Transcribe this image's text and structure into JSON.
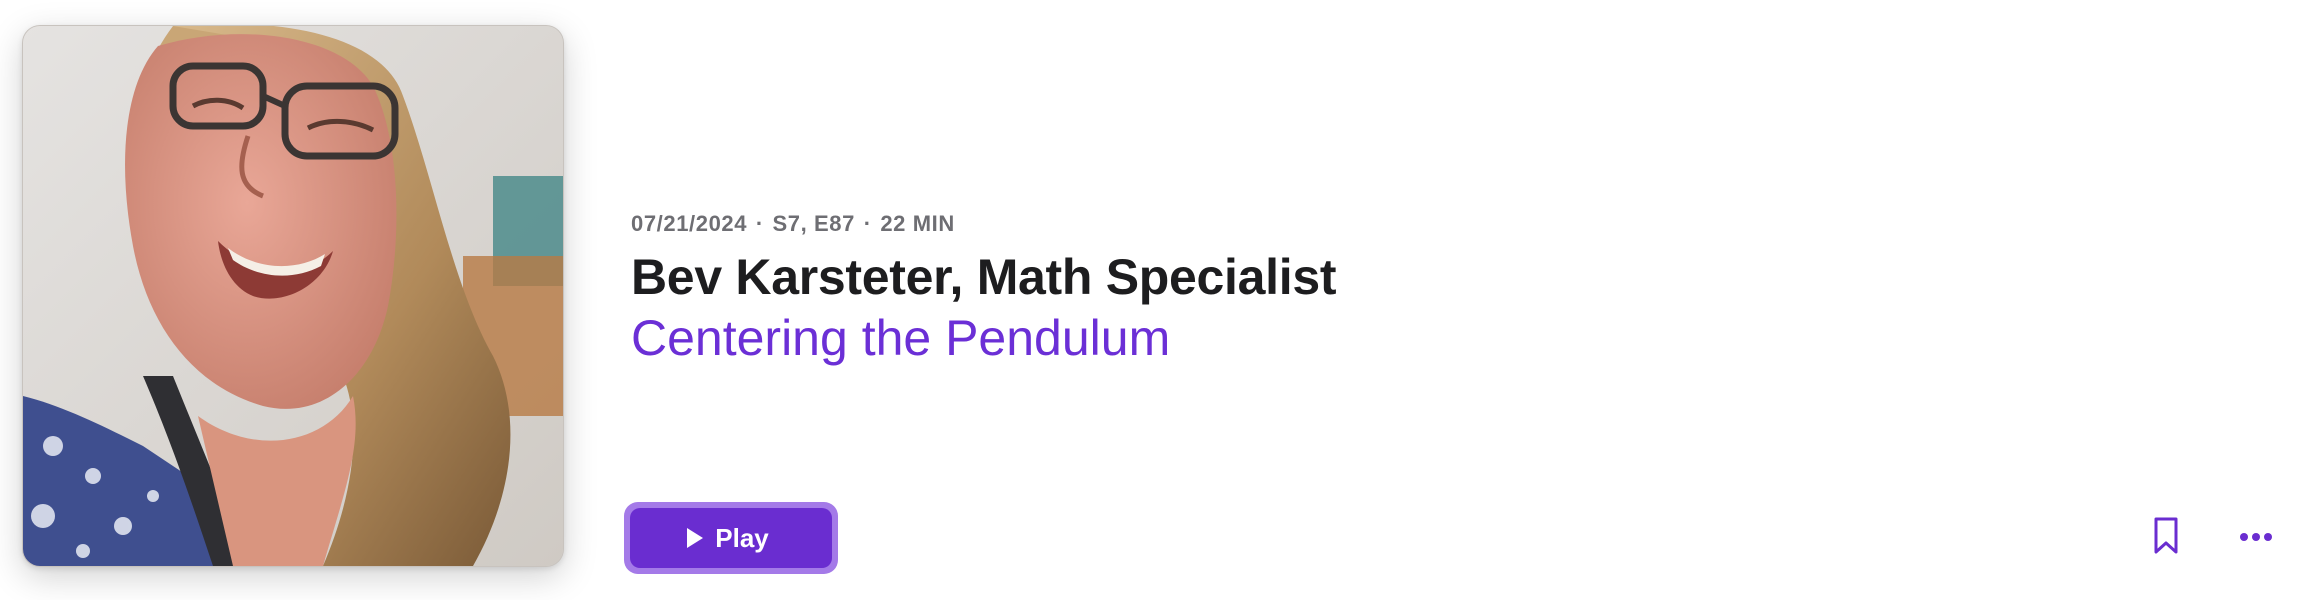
{
  "episode": {
    "date": "07/21/2024",
    "season_episode": "S7, E87",
    "duration": "22 MIN",
    "separator": "·",
    "title": "Bev Karsteter, Math Specialist",
    "show_title": "Centering the Pendulum"
  },
  "actions": {
    "play_label": "Play",
    "play_icon": "play-icon",
    "bookmark_icon": "bookmark-icon",
    "more_icon": "more-icon"
  },
  "colors": {
    "accent": "#6a2dd0",
    "accent_light": "#a47ae8",
    "show_link": "#6b2fd6",
    "title": "#1d1d1f",
    "meta": "#6e6e73"
  }
}
